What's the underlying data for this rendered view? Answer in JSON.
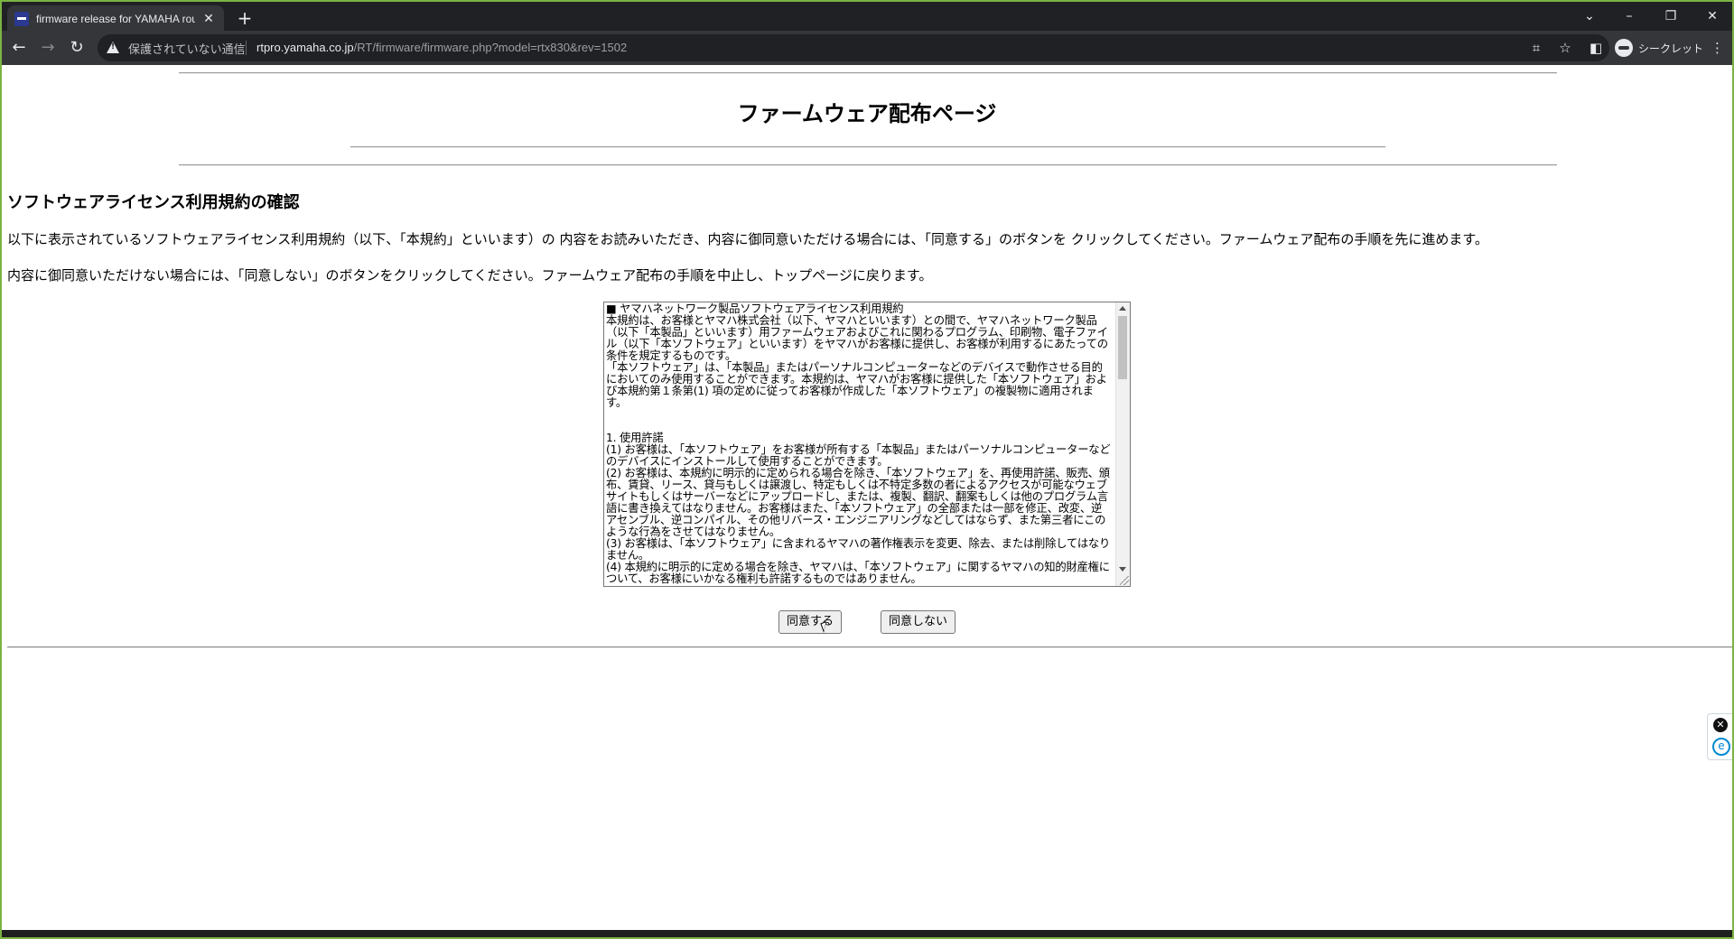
{
  "browser": {
    "tab_title": "firmware release for YAMAHA router",
    "tab_close": "✕",
    "new_tab": "+",
    "window_controls": {
      "tab_search": "⌄",
      "minimize": "–",
      "restore": "❐",
      "close": "✕"
    },
    "nav": {
      "back": "←",
      "forward": "→",
      "reload": "↻"
    },
    "security_label": "保護されていない通信",
    "url_host": "rtpro.yamaha.co.jp",
    "url_path": "/RT/firmware/firmware.php?model=rtx830&rev=1502",
    "incognito_label": "シークレット",
    "icons": [
      "warning-icon",
      "translate-icon",
      "star-icon",
      "sidepanel-icon",
      "incognito-icon",
      "menu-icon"
    ]
  },
  "page": {
    "title": "ファームウェア配布ページ",
    "section_heading": "ソフトウェアライセンス利用規約の確認",
    "paragraph1": "以下に表示されているソフトウェアライセンス利用規約（以下、「本規約」といいます）の 内容をお読みいただき、内容に御同意いただける場合には、「同意する」のボタンを クリックしてください。ファームウェア配布の手順を先に進めます。",
    "paragraph2": "内容に御同意いただけない場合には、「同意しない」のボタンをクリックしてください。ファームウェア配布の手順を中止し、トップページに戻ります。",
    "license_text": "■ ヤマハネットワーク製品ソフトウェアライセンス利用規約\n本規約は、お客様とヤマハ株式会社（以下、ヤマハといいます）との間で、ヤマハネットワーク製品（以下「本製品」といいます）用ファームウェアおよびこれに関わるプログラム、印刷物、電子ファイル（以下「本ソフトウェア」といいます）をヤマハがお客様に提供し、お客様が利用するにあたっての条件を規定するものです。\n「本ソフトウェア」は、「本製品」またはパーソナルコンピューターなどのデバイスで動作させる目的においてのみ使用することができます。本規約は、ヤマハがお客様に提供した「本ソフトウェア」および本規約第１条第(1) 項の定めに従ってお客様が作成した「本ソフトウェア」の複製物に適用されます。\n\n\n1. 使用許諾\n(1) お客様は、「本ソフトウェア」をお客様が所有する「本製品」またはパーソナルコンピューターなどのデバイスにインストールして使用することができます。\n(2) お客様は、本規約に明示的に定められる場合を除き、「本ソフトウェア」を、再使用許諾、販売、頒布、賃貸、リース、貸与もしくは譲渡し、特定もしくは不特定多数の者によるアクセスが可能なウェブサイトもしくはサーバーなどにアップロードし、または、複製、翻訳、翻案もしくは他のプログラム言語に書き換えてはなりません。お客様はまた、「本ソフトウェア」の全部または一部を修正、改変、逆アセンブル、逆コンパイル、その他リバース・エンジニアリングなどしてはならず、また第三者にこのような行為をさせてはなりません。\n(3) お客様は、「本ソフトウェア」に含まれるヤマハの著作権表示を変更、除去、または削除してはなりません。\n(4) 本規約に明示的に定める場合を除き、ヤマハは、「本ソフトウェア」に関するヤマハの知的財産権について、お客様にいかなる権利も許諾するものではありません。",
    "agree_button": "同意する",
    "disagree_button": "同意しない"
  },
  "extension": {
    "close": "✕",
    "label": "e"
  }
}
